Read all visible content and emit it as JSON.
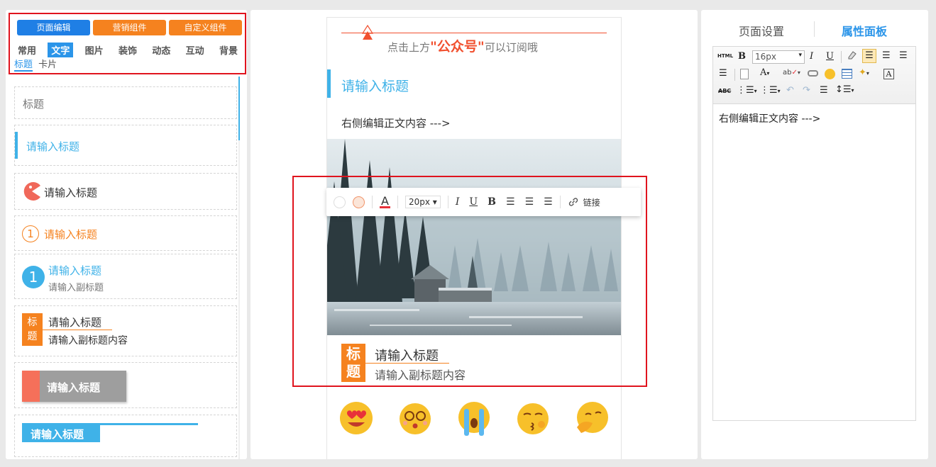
{
  "left_panel": {
    "top_buttons": [
      "页面编辑",
      "营销组件",
      "自定义组件"
    ],
    "categories": [
      "常用",
      "文字",
      "图片",
      "装饰",
      "动态",
      "互动",
      "背景"
    ],
    "active_category": "文字",
    "subtabs": [
      "标题",
      "卡片"
    ],
    "items": {
      "plain_title": "标题",
      "blue_bar_title": "请输入标题",
      "pacman_title": "请输入标题",
      "circle_one_title": "请输入标题",
      "circle_one_number": "1",
      "blue_circle_number": "1",
      "blue_circle_title": "请输入标题",
      "blue_circle_subtitle": "请输入副标题",
      "orange_tag_char1": "标",
      "orange_tag_char2": "题",
      "orange_tag_title": "请输入标题",
      "orange_tag_subtitle": "请输入副标题内容",
      "gray_block_title": "请输入标题",
      "blue_tab_title": "请输入标题"
    }
  },
  "preview": {
    "follow_prefix": "点击上方",
    "follow_highlight": "\"公众号\"",
    "follow_suffix": "可以订阅哦",
    "title": "请输入标题",
    "body": "右侧编辑正文内容 --->",
    "card_char1": "标",
    "card_char2": "题",
    "card_title": "请输入标题",
    "card_subtitle": "请输入副标题内容",
    "floating_toolbar": {
      "font_size": "20px",
      "link_label": "链接"
    }
  },
  "right_panel": {
    "tab_page_settings": "页面设置",
    "tab_properties": "属性面板",
    "toolbar": {
      "html_label": "HTML",
      "font_size": "16px",
      "strike_label": "ABC"
    },
    "editor_content": "右侧编辑正文内容 --->"
  },
  "colors": {
    "accent_blue": "#2b95e9",
    "orange": "#f5821f",
    "title_blue": "#3fb2e8",
    "highlight_red": "#f1502f",
    "selection_red": "#e0141e"
  }
}
